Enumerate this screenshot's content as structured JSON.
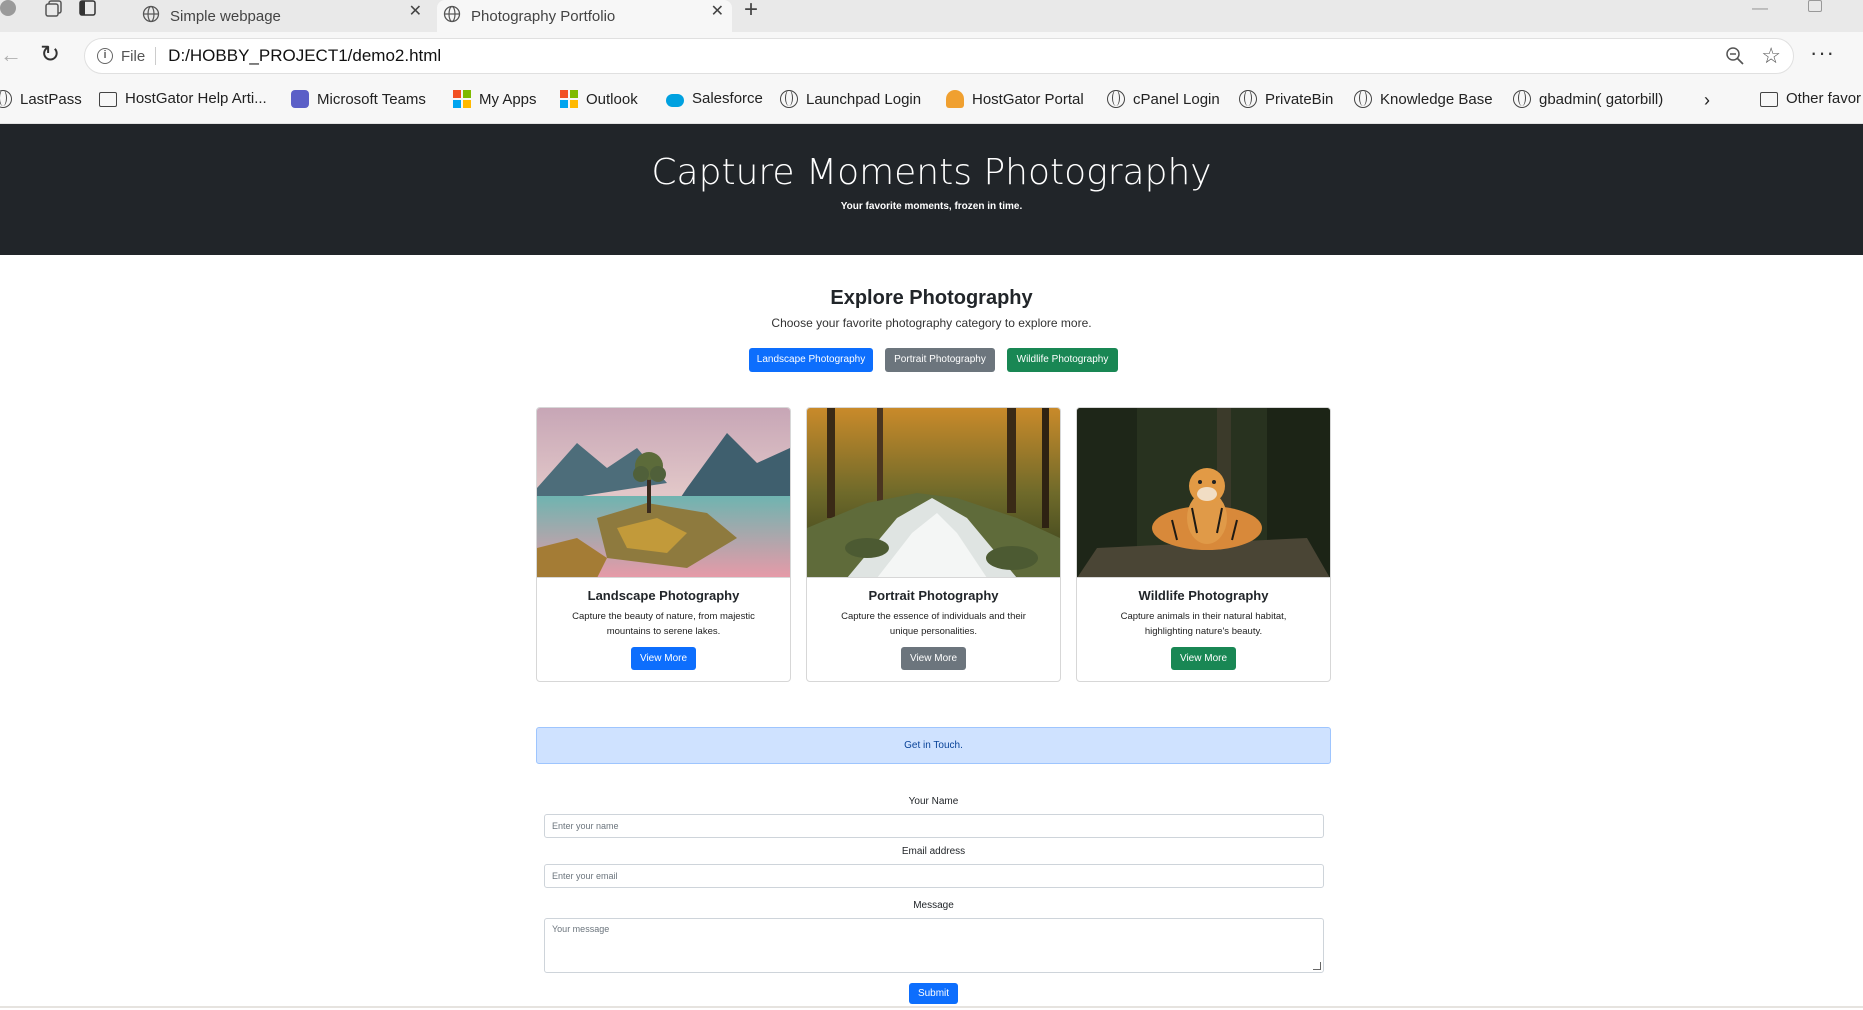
{
  "browser": {
    "tabs": [
      {
        "title": "Simple webpage"
      },
      {
        "title": "Photography Portfolio"
      }
    ],
    "address": {
      "scheme_label": "File",
      "url": "D:/HOBBY_PROJECT1/demo2.html"
    },
    "more_label": "···",
    "bookmarks": [
      {
        "label": "LastPass",
        "icon": "globe-icon"
      },
      {
        "label": "HostGator Help Arti...",
        "icon": "folder-icon"
      },
      {
        "label": "Microsoft Teams",
        "icon": "teams-icon"
      },
      {
        "label": "My Apps",
        "icon": "microsoft-icon"
      },
      {
        "label": "Outlook",
        "icon": "microsoft-icon"
      },
      {
        "label": "Salesforce",
        "icon": "salesforce-icon"
      },
      {
        "label": "Launchpad Login",
        "icon": "globe-icon"
      },
      {
        "label": "HostGator Portal",
        "icon": "hostgator-icon"
      },
      {
        "label": "cPanel Login",
        "icon": "globe-icon"
      },
      {
        "label": "PrivateBin",
        "icon": "globe-icon"
      },
      {
        "label": "Knowledge Base",
        "icon": "globe-icon"
      },
      {
        "label": "gbadmin( gatorbill)",
        "icon": "globe-icon"
      },
      {
        "label": "Other favor",
        "icon": "folder-icon"
      }
    ]
  },
  "hero": {
    "title": "Capture Moments Photography",
    "subtitle": "Your favorite moments, frozen in time."
  },
  "explore": {
    "title": "Explore Photography",
    "subtitle": "Choose your favorite photography category to explore more.",
    "buttons": [
      {
        "label": "Landscape Photography",
        "color": "#0d6efd"
      },
      {
        "label": "Portrait Photography",
        "color": "#6c757d"
      },
      {
        "label": "Wildlife Photography",
        "color": "#198754"
      }
    ]
  },
  "cards": [
    {
      "title": "Landscape Photography",
      "text": "Capture the beauty of nature, from majestic mountains to serene lakes.",
      "button": "View More",
      "button_color": "#0d6efd"
    },
    {
      "title": "Portrait Photography",
      "text": "Capture the essence of individuals and their unique personalities.",
      "button": "View More",
      "button_color": "#6c757d"
    },
    {
      "title": "Wildlife Photography",
      "text": "Capture animals in their natural habitat, highlighting nature's beauty.",
      "button": "View More",
      "button_color": "#198754"
    }
  ],
  "contact": {
    "alert": "Get in Touch.",
    "name_label": "Your Name",
    "name_placeholder": "Enter your name",
    "email_label": "Email address",
    "email_placeholder": "Enter your email",
    "message_label": "Message",
    "message_placeholder": "Your message",
    "submit_label": "Submit"
  }
}
